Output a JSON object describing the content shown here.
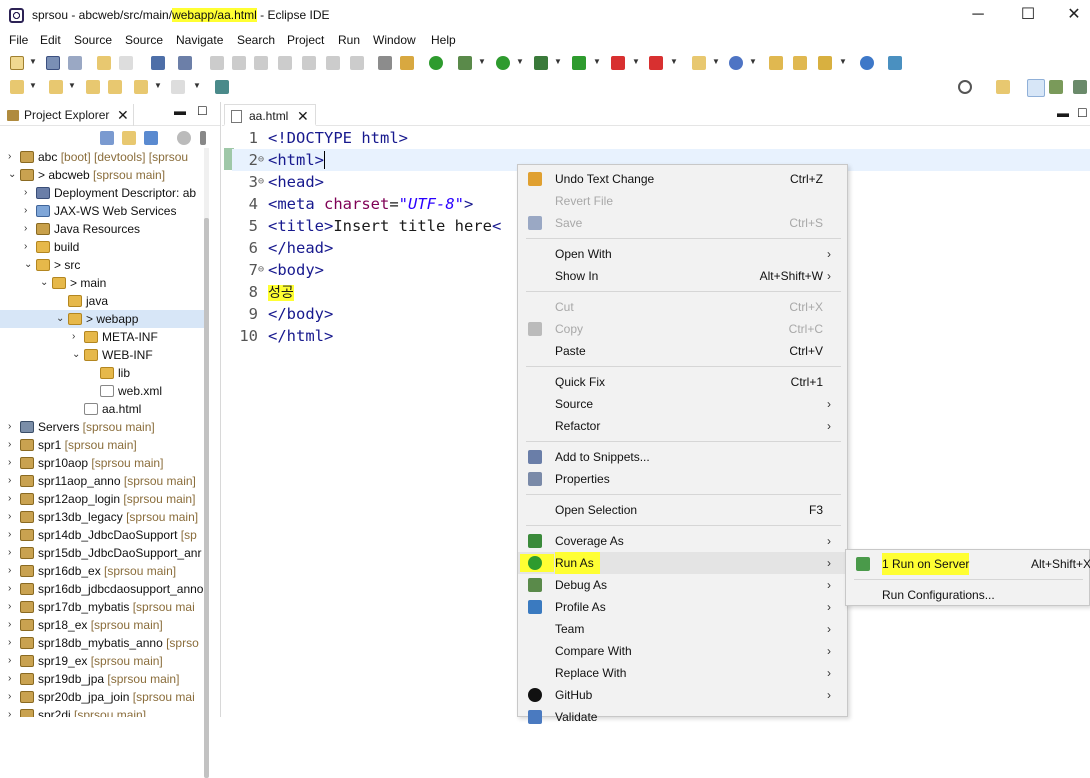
{
  "window": {
    "title_prefix": "sprsou - abcweb/src/main/",
    "title_highlight": "webapp/aa.html",
    "title_suffix": " - Eclipse IDE",
    "minimize": "─",
    "maximize": "☐",
    "close": "✕"
  },
  "menubar": [
    "File",
    "Edit",
    "Source",
    "Source",
    "Navigate",
    "Search",
    "Project",
    "Run",
    "Window",
    "Help"
  ],
  "project_explorer": {
    "tab_label": "Project Explorer",
    "close": "✕",
    "tree": [
      {
        "label": "abc",
        "decoration": " [boot] [devtools] [sprsou",
        "twisty": "›",
        "icon": "proj"
      },
      {
        "label": "> abcweb",
        "decoration": " [sprsou main]",
        "twisty": "⌄",
        "icon": "proj"
      },
      {
        "label": "Deployment Descriptor: ab",
        "decoration": "",
        "twisty": "›",
        "icon": "dd"
      },
      {
        "label": "JAX-WS Web Services",
        "decoration": "",
        "twisty": "›",
        "icon": "ws"
      },
      {
        "label": "Java Resources",
        "decoration": "",
        "twisty": "›",
        "icon": "jar"
      },
      {
        "label": "build",
        "decoration": "",
        "twisty": "›",
        "icon": "folder"
      },
      {
        "label": "> src",
        "decoration": "",
        "twisty": "⌄",
        "icon": "folder"
      },
      {
        "label": "> main",
        "decoration": "",
        "twisty": "⌄",
        "icon": "folder"
      },
      {
        "label": "java",
        "decoration": "",
        "twisty": "",
        "icon": "folder"
      },
      {
        "label": "> webapp",
        "decoration": "",
        "twisty": "⌄",
        "icon": "folder",
        "selected": true
      },
      {
        "label": "META-INF",
        "decoration": "",
        "twisty": "›",
        "icon": "folder"
      },
      {
        "label": "WEB-INF",
        "decoration": "",
        "twisty": "⌄",
        "icon": "folder"
      },
      {
        "label": "lib",
        "decoration": "",
        "twisty": "",
        "icon": "folder"
      },
      {
        "label": "web.xml",
        "decoration": "",
        "twisty": "",
        "icon": "file"
      },
      {
        "label": "aa.html",
        "decoration": "",
        "twisty": "",
        "icon": "file"
      },
      {
        "label": "Servers",
        "decoration": " [sprsou main]",
        "twisty": "›",
        "icon": "srv"
      },
      {
        "label": "spr1",
        "decoration": " [sprsou main]",
        "twisty": "›",
        "icon": "proj"
      },
      {
        "label": "spr10aop",
        "decoration": " [sprsou main]",
        "twisty": "›",
        "icon": "proj"
      },
      {
        "label": "spr11aop_anno",
        "decoration": " [sprsou main]",
        "twisty": "›",
        "icon": "proj"
      },
      {
        "label": "spr12aop_login",
        "decoration": " [sprsou main]",
        "twisty": "›",
        "icon": "proj"
      },
      {
        "label": "spr13db_legacy",
        "decoration": " [sprsou main]",
        "twisty": "›",
        "icon": "proj"
      },
      {
        "label": "spr14db_JdbcDaoSupport",
        "decoration": " [sp",
        "twisty": "›",
        "icon": "proj"
      },
      {
        "label": "spr15db_JdbcDaoSupport_anr",
        "decoration": "",
        "twisty": "›",
        "icon": "proj"
      },
      {
        "label": "spr16db_ex",
        "decoration": " [sprsou main]",
        "twisty": "›",
        "icon": "proj"
      },
      {
        "label": "spr16db_jdbcdaosupport_anno",
        "decoration": "",
        "twisty": "›",
        "icon": "proj"
      },
      {
        "label": "spr17db_mybatis",
        "decoration": " [sprsou mai",
        "twisty": "›",
        "icon": "proj"
      },
      {
        "label": "spr18_ex",
        "decoration": " [sprsou main]",
        "twisty": "›",
        "icon": "proj"
      },
      {
        "label": "spr18db_mybatis_anno",
        "decoration": " [sprso",
        "twisty": "›",
        "icon": "proj"
      },
      {
        "label": "spr19_ex",
        "decoration": " [sprsou main]",
        "twisty": "›",
        "icon": "proj"
      },
      {
        "label": "spr19db_jpa",
        "decoration": " [sprsou main]",
        "twisty": "›",
        "icon": "proj"
      },
      {
        "label": "spr20db_jpa_join",
        "decoration": " [sprsou mai",
        "twisty": "›",
        "icon": "proj"
      },
      {
        "label": "spr2di",
        "decoration": " [sprsou main]",
        "twisty": "›",
        "icon": "proj"
      }
    ]
  },
  "editor": {
    "tab_label": "aa.html",
    "close": "✕",
    "lines": [
      {
        "n": "1",
        "fold": "",
        "parts": [
          {
            "t": "<!DOCTYPE html>",
            "c": "tag"
          }
        ]
      },
      {
        "n": "2",
        "fold": "⊖",
        "parts": [
          {
            "t": "<html>",
            "c": "tag"
          }
        ],
        "current": true
      },
      {
        "n": "3",
        "fold": "⊖",
        "parts": [
          {
            "t": "<head>",
            "c": "tag"
          }
        ]
      },
      {
        "n": "4",
        "fold": "",
        "parts": [
          {
            "t": "<meta ",
            "c": "tag"
          },
          {
            "t": "charset",
            "c": "attr"
          },
          {
            "t": "=",
            "c": ""
          },
          {
            "t": "\"UTF-8\"",
            "c": "str"
          },
          {
            "t": ">",
            "c": "tag"
          }
        ]
      },
      {
        "n": "5",
        "fold": "",
        "parts": [
          {
            "t": "<title>",
            "c": "tag"
          },
          {
            "t": "Insert title here",
            "c": ""
          },
          {
            "t": "<",
            "c": "tag"
          }
        ]
      },
      {
        "n": "6",
        "fold": "",
        "parts": [
          {
            "t": "</head>",
            "c": "tag"
          }
        ]
      },
      {
        "n": "7",
        "fold": "⊖",
        "parts": [
          {
            "t": "<body>",
            "c": "tag"
          }
        ]
      },
      {
        "n": "8",
        "fold": "",
        "parts": [
          {
            "t": "성공",
            "c": "korean"
          }
        ]
      },
      {
        "n": "9",
        "fold": "",
        "parts": [
          {
            "t": "</body>",
            "c": "tag"
          }
        ]
      },
      {
        "n": "10",
        "fold": "",
        "parts": [
          {
            "t": "</html>",
            "c": "tag"
          }
        ]
      }
    ]
  },
  "context_menu": {
    "items": [
      {
        "label": "Undo Text Change",
        "key": "Ctrl+Z",
        "icon": "undo"
      },
      {
        "label": "Revert File",
        "key": "",
        "disabled": true
      },
      {
        "label": "Save",
        "key": "Ctrl+S",
        "disabled": true,
        "icon": "save"
      },
      {
        "sep": true
      },
      {
        "label": "Open With",
        "key": "",
        "arrow": true
      },
      {
        "label": "Show In",
        "key": "Alt+Shift+W",
        "arrow": true
      },
      {
        "sep": true
      },
      {
        "label": "Cut",
        "key": "Ctrl+X",
        "disabled": true
      },
      {
        "label": "Copy",
        "key": "Ctrl+C",
        "disabled": true,
        "icon": "copy"
      },
      {
        "label": "Paste",
        "key": "Ctrl+V"
      },
      {
        "sep": true
      },
      {
        "label": "Quick Fix",
        "key": "Ctrl+1"
      },
      {
        "label": "Source",
        "key": "",
        "arrow": true
      },
      {
        "label": "Refactor",
        "key": "",
        "arrow": true
      },
      {
        "sep": true
      },
      {
        "label": "Add to Snippets...",
        "key": "",
        "icon": "snippet"
      },
      {
        "label": "Properties",
        "key": "",
        "icon": "props"
      },
      {
        "sep": true
      },
      {
        "label": "Open Selection",
        "key": "F3"
      },
      {
        "sep": true
      },
      {
        "label": "Coverage As",
        "key": "",
        "arrow": true,
        "icon": "coverage"
      },
      {
        "label": "Run As",
        "key": "",
        "arrow": true,
        "icon": "run",
        "hover": true,
        "highlight": true
      },
      {
        "label": "Debug As",
        "key": "",
        "arrow": true,
        "icon": "debug"
      },
      {
        "label": "Profile As",
        "key": "",
        "arrow": true,
        "icon": "profile"
      },
      {
        "label": "Team",
        "key": "",
        "arrow": true
      },
      {
        "label": "Compare With",
        "key": "",
        "arrow": true
      },
      {
        "label": "Replace With",
        "key": "",
        "arrow": true
      },
      {
        "label": "GitHub",
        "key": "",
        "arrow": true,
        "icon": "github"
      },
      {
        "label": "Validate",
        "key": "",
        "icon": "validate"
      }
    ]
  },
  "submenu": {
    "items": [
      {
        "label": "1 Run on Server",
        "key": "Alt+Shift+X",
        "highlight": true,
        "icon": "server"
      },
      {
        "sep": true
      },
      {
        "label": "Run Configurations...",
        "key": ""
      }
    ]
  },
  "colors": {
    "highlight": "#ffff33",
    "selection": "#d7e6f7",
    "tag": "#17198e",
    "attr": "#7f0055",
    "string": "#2a00ff"
  }
}
